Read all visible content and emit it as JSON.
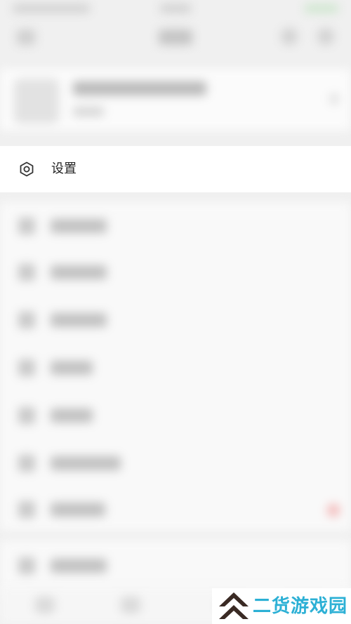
{
  "settings": {
    "label": "设置",
    "icon": "settings-hexagon-icon"
  },
  "watermark": {
    "text": "二货游戏园"
  },
  "colors": {
    "watermark_text": "#2cb0d5",
    "watermark_logo": "#3a2a24",
    "notification_dot": "#f3b6b6"
  }
}
